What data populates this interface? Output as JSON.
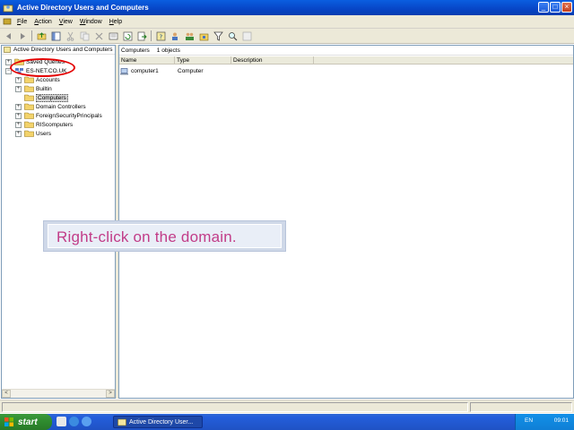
{
  "window": {
    "title": "Active Directory Users and Computers",
    "buttons": {
      "minimize": "_",
      "maximize": "□",
      "close": "×"
    }
  },
  "menubar": {
    "items": [
      "File",
      "Action",
      "View",
      "Window",
      "Help"
    ]
  },
  "left_pane": {
    "header": "Active Directory Users and Computers",
    "tree": [
      {
        "label": "Saved Queries",
        "expander": "+"
      },
      {
        "label": "ES-NET.CO.UK",
        "expander": "−"
      },
      {
        "label": "Accounts",
        "expander": "+"
      },
      {
        "label": "Builtin",
        "expander": "+"
      },
      {
        "label": "Computers",
        "expander": "",
        "selected": true
      },
      {
        "label": "Domain Controllers",
        "expander": "+"
      },
      {
        "label": "ForeignSecurityPrincipals",
        "expander": "+"
      },
      {
        "label": "RIScomputers",
        "expander": "+"
      },
      {
        "label": "Users",
        "expander": "+"
      }
    ],
    "scroll_left": "<",
    "scroll_right": ">"
  },
  "right_pane": {
    "container": "Computers",
    "count": "1 objects",
    "columns": [
      "Name",
      "Type",
      "Description"
    ],
    "rows": [
      {
        "name": "computer1",
        "type": "Computer",
        "description": ""
      }
    ]
  },
  "caption": {
    "text": "Right-click on the domain."
  },
  "taskbar": {
    "start_label": "start",
    "task_label": "Active Directory User...",
    "language": "EN",
    "clock": "09:01"
  },
  "colors": {
    "titlebar": "#0a5ee0",
    "highlight_circle": "#e40000",
    "caption_text": "#c23c88",
    "taskbar": "#245edb",
    "start_button": "#2e8a2e"
  },
  "icons": {
    "app": "ad-users-computers-icon",
    "folder": "folder-icon",
    "computer": "computer-icon",
    "domain": "domain-icon"
  }
}
